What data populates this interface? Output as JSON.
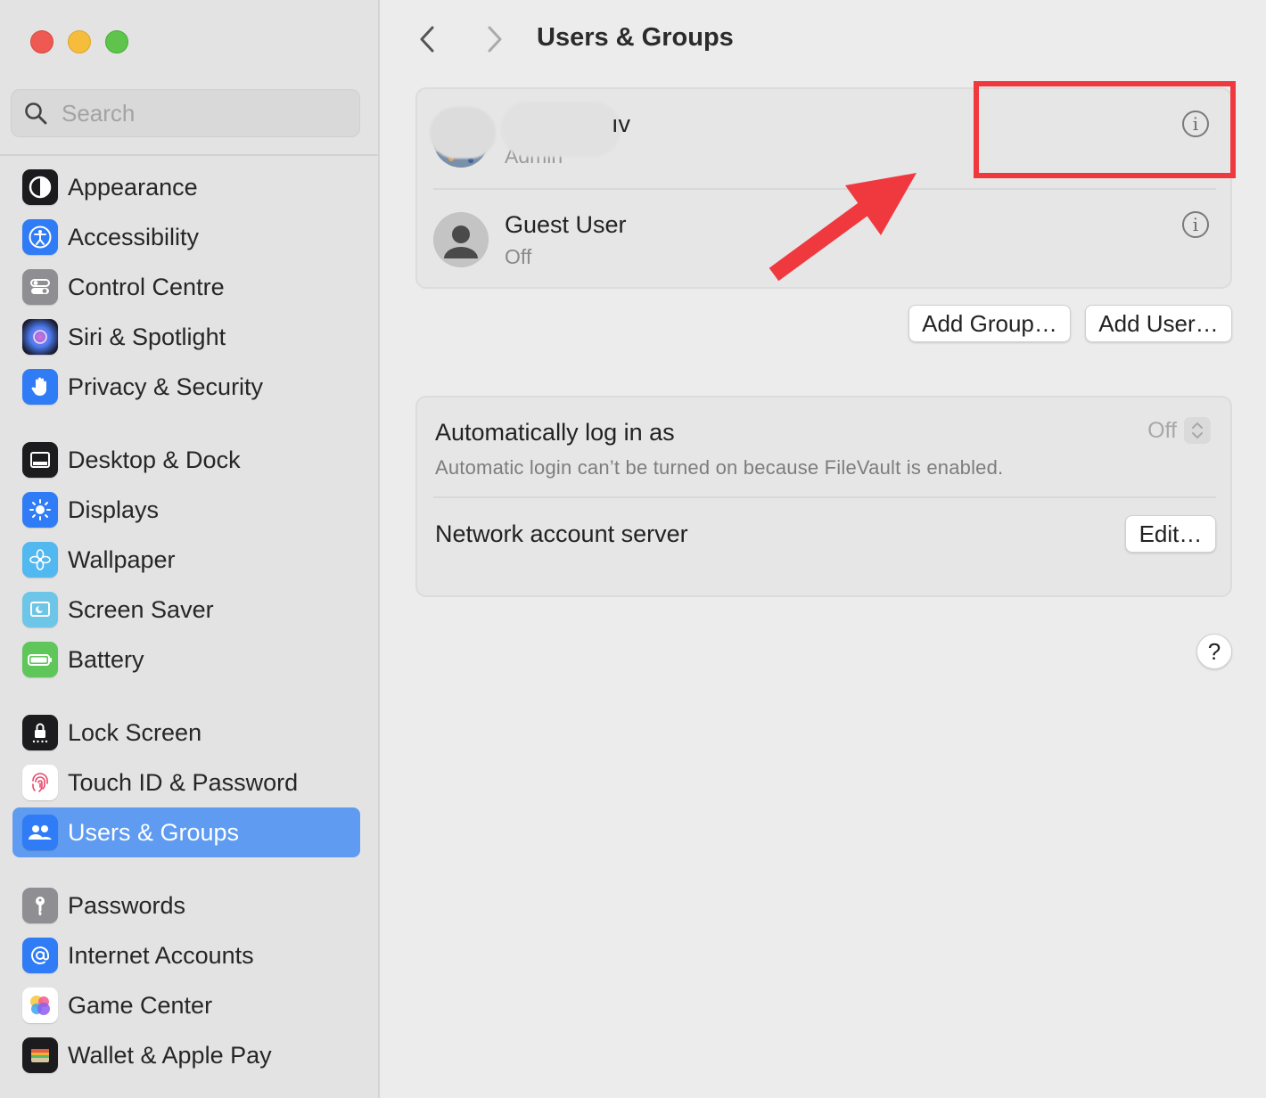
{
  "sidebar": {
    "search_placeholder": "Search",
    "items": [
      {
        "label": "Appearance",
        "icon": "appearance-icon",
        "color": "#1c1c1e"
      },
      {
        "label": "Accessibility",
        "icon": "accessibility-icon",
        "color": "#2f7cf6"
      },
      {
        "label": "Control Centre",
        "icon": "control-centre-icon",
        "color": "#8e8e93"
      },
      {
        "label": "Siri & Spotlight",
        "icon": "siri-icon",
        "color": "#3a2a6a"
      },
      {
        "label": "Privacy & Security",
        "icon": "hand-icon",
        "color": "#2f7cf6"
      },
      {
        "label": "Desktop & Dock",
        "icon": "dock-icon",
        "color": "#1c1c1e"
      },
      {
        "label": "Displays",
        "icon": "sun-icon",
        "color": "#2f7cf6"
      },
      {
        "label": "Wallpaper",
        "icon": "flower-icon",
        "color": "#52b8f0"
      },
      {
        "label": "Screen Saver",
        "icon": "screen-saver-icon",
        "color": "#6dc6e8"
      },
      {
        "label": "Battery",
        "icon": "battery-icon",
        "color": "#5fc65a"
      },
      {
        "label": "Lock Screen",
        "icon": "lock-icon",
        "color": "#1c1c1e"
      },
      {
        "label": "Touch ID & Password",
        "icon": "fingerprint-icon",
        "color": "#ffffff"
      },
      {
        "label": "Users & Groups",
        "icon": "users-icon",
        "color": "#2f7cf6",
        "selected": true
      },
      {
        "label": "Passwords",
        "icon": "key-icon",
        "color": "#8e8e93"
      },
      {
        "label": "Internet Accounts",
        "icon": "at-icon",
        "color": "#2f7cf6"
      },
      {
        "label": "Game Center",
        "icon": "game-center-icon",
        "color": "#ffffff"
      },
      {
        "label": "Wallet & Apple Pay",
        "icon": "wallet-icon",
        "color": "#1c1c1e"
      }
    ]
  },
  "header": {
    "title": "Users & Groups"
  },
  "users": [
    {
      "name_visible": "ıv",
      "role": "Admin"
    },
    {
      "name": "Guest User",
      "role": "Off"
    }
  ],
  "actions": {
    "add_group": "Add Group…",
    "add_user": "Add User…"
  },
  "login": {
    "auto_login_label": "Automatically log in as",
    "auto_login_value": "Off",
    "auto_login_note": "Automatic login can’t be turned on because FileVault is enabled.",
    "network_label": "Network account server",
    "edit_label": "Edit…"
  },
  "help_label": "?",
  "annotation": {
    "color": "#f0393f"
  }
}
